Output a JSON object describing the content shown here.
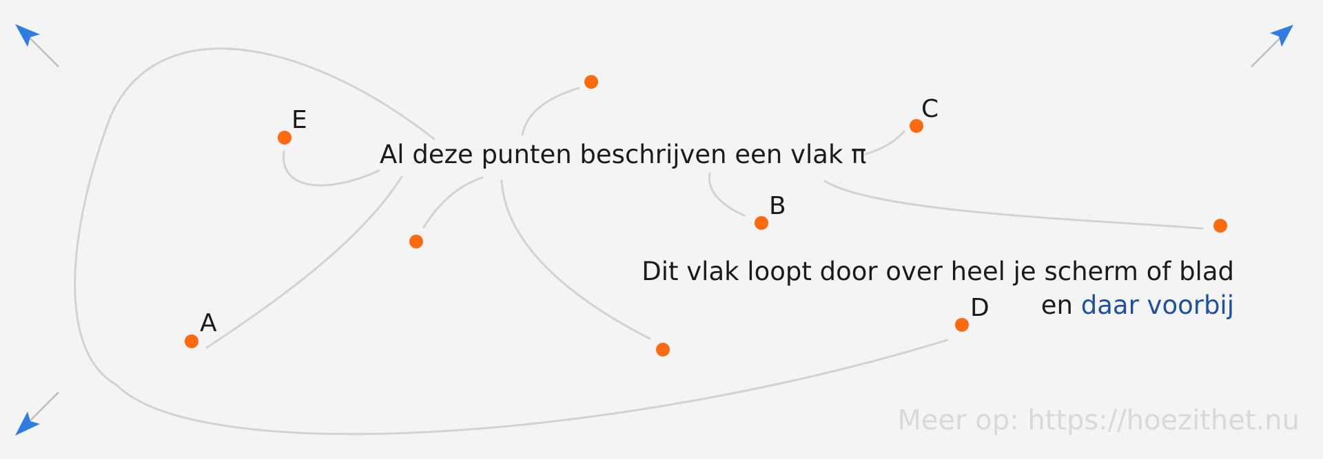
{
  "colors": {
    "point": "#ff6a10",
    "curve": "#d2d2d2",
    "link": "#1f4fa0",
    "arrow": "#2f7de0",
    "background": "#f4f4f4"
  },
  "main_statement": "Al deze punten beschrijven een vlak π",
  "extension_line_1": "Dit vlak loopt door over heel je scherm of blad",
  "extension_prefix": "en",
  "extension_link": "daar voorbij",
  "footer": "Meer op: https://hoezithet.nu",
  "points": {
    "A": "A",
    "B": "B",
    "C": "C",
    "D": "D",
    "E": "E"
  },
  "icons": [
    "arrow-up-left-icon",
    "arrow-up-right-icon",
    "arrow-down-left-icon"
  ]
}
